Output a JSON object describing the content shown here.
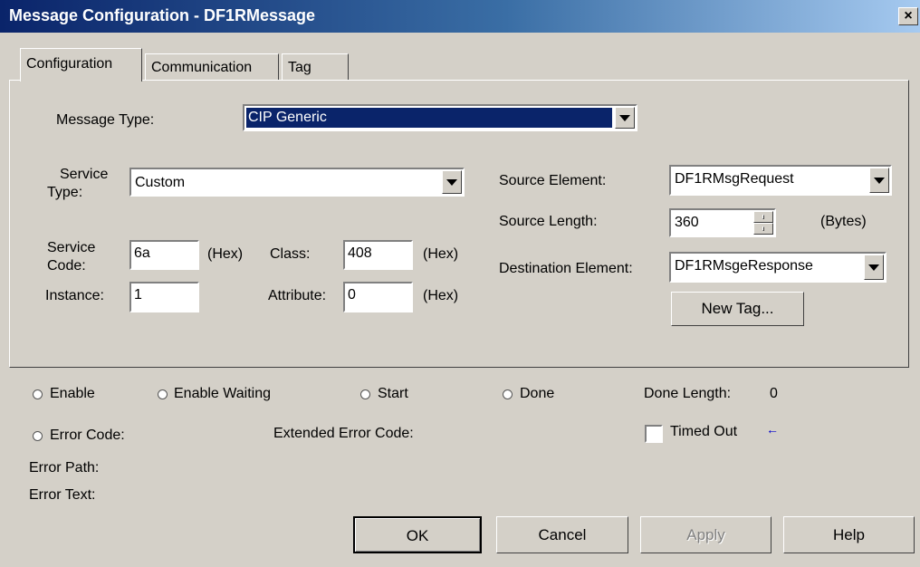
{
  "window": {
    "title": "Message Configuration - DF1RMessage",
    "close_label": "×"
  },
  "tabs": [
    {
      "label": "Configuration",
      "active": true
    },
    {
      "label": "Communication",
      "active": false
    },
    {
      "label": "Tag",
      "active": false
    }
  ],
  "config": {
    "message_type_label": "Message Type:",
    "message_type_value": "CIP Generic",
    "service_type_label_1": "Service",
    "service_type_label_2": "Type:",
    "service_type_value": "Custom",
    "service_code_label_1": "Service",
    "service_code_label_2": "Code:",
    "service_code_value": "6a",
    "hex_label": "(Hex)",
    "class_label": "Class:",
    "class_value": "408",
    "instance_label": "Instance:",
    "instance_value": "1",
    "attribute_label": "Attribute:",
    "attribute_value": "0",
    "source_element_label": "Source Element:",
    "source_element_value": "DF1RMsgRequest",
    "source_length_label": "Source Length:",
    "source_length_value": "360",
    "bytes_label": "(Bytes)",
    "destination_element_label": "Destination Element:",
    "destination_element_value": "DF1RMsgeResponse",
    "new_tag_label": "New Tag..."
  },
  "status": {
    "enable": "Enable",
    "enable_waiting": "Enable Waiting",
    "start": "Start",
    "done": "Done",
    "done_length_label": "Done Length:",
    "done_length_value": "0",
    "error_code_label": "Error Code:",
    "extended_error_code_label": "Extended Error Code:",
    "timed_out_label": "Timed Out",
    "timed_out_arrow": "←",
    "error_path_label": "Error Path:",
    "error_text_label": "Error Text:"
  },
  "buttons": {
    "ok": "OK",
    "cancel": "Cancel",
    "apply": "Apply",
    "help": "Help"
  },
  "colors": {
    "title_bar": "#0a246a",
    "selection": "#0a246a",
    "dialog_bg": "#d4d0c8",
    "disabled_text": "#808080",
    "arrow": "#0000cc"
  }
}
